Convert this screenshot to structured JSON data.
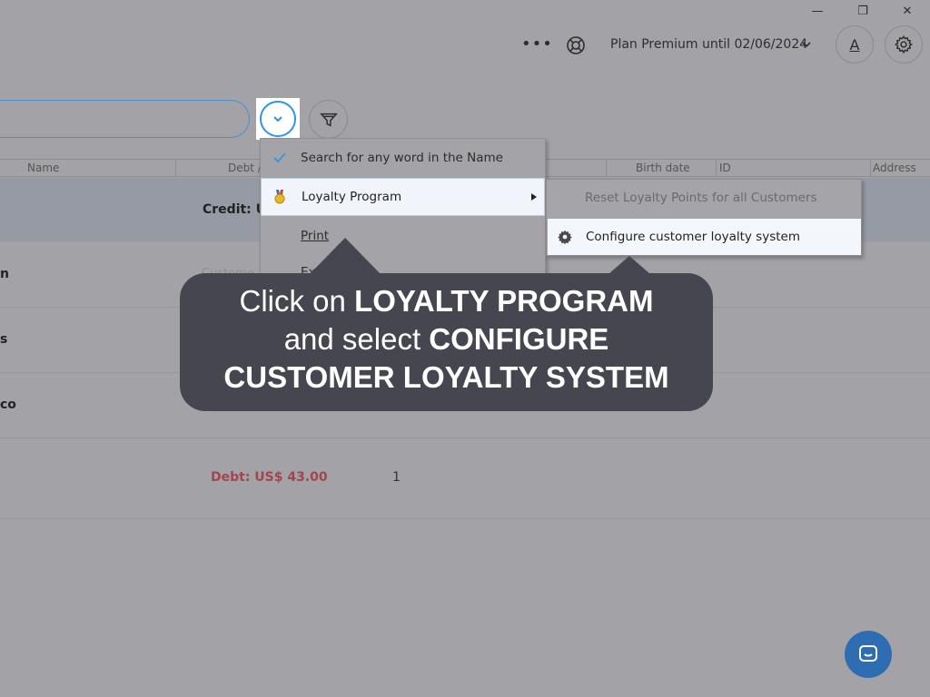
{
  "window": {
    "minimize_glyph": "—",
    "restore_glyph": "❐",
    "close_glyph": "✕"
  },
  "topbar": {
    "more_glyph": "•••",
    "plan_label": "Plan Premium until 02/06/2024",
    "avatar_letter": "A"
  },
  "table": {
    "headers": {
      "name": "Name",
      "debt": "Debt /",
      "birth_date": "Birth date",
      "id": "ID",
      "address": "Address"
    },
    "rows": [
      {
        "name_tail": "",
        "credit": "Credit: US"
      },
      {
        "name_tail": "n",
        "hidden_text": "Custome"
      },
      {
        "name_tail": "s"
      },
      {
        "name_tail": "co"
      },
      {
        "name_tail": "",
        "debt": "Debt: US$ 43.00",
        "id": "1"
      }
    ]
  },
  "menu": {
    "items": [
      {
        "label": "Search for any word in the Name",
        "checked": true
      },
      {
        "label": "Loyalty Program",
        "icon": "medal-icon",
        "has_submenu": true
      },
      {
        "label": "Print"
      },
      {
        "label": "Expo"
      }
    ],
    "submenu": {
      "items": [
        {
          "label": "Reset Loyalty Points for all Customers",
          "disabled": true
        },
        {
          "label": "Configure customer loyalty system",
          "icon": "gear-icon"
        }
      ]
    }
  },
  "tooltip": {
    "line1_pre": "Click on ",
    "line1_bold": "LOYALTY PROGRAM",
    "line2_pre": "and select ",
    "line2_bold": "CONFIGURE",
    "line3_bold": "CUSTOMER LOYALTY SYSTEM"
  },
  "colors": {
    "overlay": "#a3a2a6",
    "accent": "#2f94e4",
    "tooltip_bg": "#464651",
    "debt": "#a3454d",
    "chat": "#2e6db2"
  }
}
